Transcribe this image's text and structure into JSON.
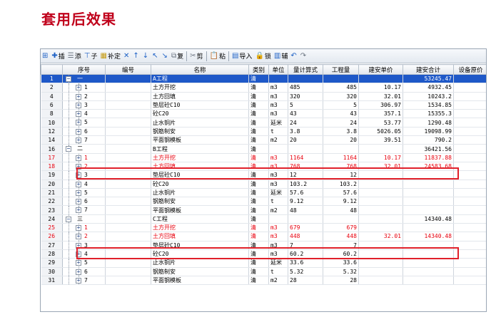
{
  "heading": "套用后效果",
  "toolbar": {
    "insert": "插",
    "add": "添",
    "child": "子",
    "supplement": "补定",
    "copy": "复",
    "cut": "剪",
    "paste": "粘",
    "import": "导入",
    "lock": "锁",
    "aux": "辅"
  },
  "columns": [
    "序号",
    "编号",
    "名称",
    "类别",
    "单位",
    "量计算式",
    "工程量",
    "建安单价",
    "建安合计",
    "设备原价"
  ],
  "rows": [
    {
      "row": "1",
      "seq": "一",
      "code": "",
      "name": "A工程",
      "type": "清",
      "unit": "",
      "formula": "",
      "qty": "",
      "price": "",
      "total": "53245.47",
      "level": 1,
      "state": "selected"
    },
    {
      "row": "2",
      "seq": "1",
      "code": "",
      "name": "土方开挖",
      "type": "清",
      "unit": "m3",
      "formula": "485",
      "qty": "485",
      "price": "10.17",
      "total": "4932.45",
      "level": 2,
      "state": ""
    },
    {
      "row": "4",
      "seq": "2",
      "code": "",
      "name": "土方回填",
      "type": "清",
      "unit": "m3",
      "formula": "320",
      "qty": "320",
      "price": "32.01",
      "total": "10243.2",
      "level": 2,
      "state": ""
    },
    {
      "row": "6",
      "seq": "3",
      "code": "",
      "name": "垫层砼C10",
      "type": "清",
      "unit": "m3",
      "formula": "5",
      "qty": "5",
      "price": "306.97",
      "total": "1534.85",
      "level": 2,
      "state": ""
    },
    {
      "row": "8",
      "seq": "4",
      "code": "",
      "name": "砼C20",
      "type": "清",
      "unit": "m3",
      "formula": "43",
      "qty": "43",
      "price": "357.1",
      "total": "15355.3",
      "level": 2,
      "state": ""
    },
    {
      "row": "10",
      "seq": "5",
      "code": "",
      "name": "止水铜片",
      "type": "清",
      "unit": "延米",
      "formula": "24",
      "qty": "24",
      "price": "53.77",
      "total": "1290.48",
      "level": 2,
      "state": ""
    },
    {
      "row": "12",
      "seq": "6",
      "code": "",
      "name": "钢筋制安",
      "type": "清",
      "unit": "t",
      "formula": "3.8",
      "qty": "3.8",
      "price": "5026.05",
      "total": "19098.99",
      "level": 2,
      "state": ""
    },
    {
      "row": "14",
      "seq": "7",
      "code": "",
      "name": "平面钢模板",
      "type": "清",
      "unit": "m2",
      "formula": "20",
      "qty": "20",
      "price": "39.51",
      "total": "790.2",
      "level": 2,
      "state": ""
    },
    {
      "row": "16",
      "seq": "二",
      "code": "",
      "name": "B工程",
      "type": "清",
      "unit": "",
      "formula": "",
      "qty": "",
      "price": "",
      "total": "36421.56",
      "level": 1,
      "state": ""
    },
    {
      "row": "17",
      "seq": "1",
      "code": "",
      "name": "土方开挖",
      "type": "清",
      "unit": "m3",
      "formula": "1164",
      "qty": "1164",
      "price": "10.17",
      "total": "11837.88",
      "level": 2,
      "state": "highlight"
    },
    {
      "row": "18",
      "seq": "2",
      "code": "",
      "name": "土方回填",
      "type": "清",
      "unit": "m3",
      "formula": "768",
      "qty": "768",
      "price": "32.01",
      "total": "24583.68",
      "level": 2,
      "state": "highlight"
    },
    {
      "row": "19",
      "seq": "3",
      "code": "",
      "name": "垫层砼C10",
      "type": "清",
      "unit": "m3",
      "formula": "12",
      "qty": "12",
      "price": "",
      "total": "",
      "level": 2,
      "state": ""
    },
    {
      "row": "20",
      "seq": "4",
      "code": "",
      "name": "砼C20",
      "type": "清",
      "unit": "m3",
      "formula": "103.2",
      "qty": "103.2",
      "price": "",
      "total": "",
      "level": 2,
      "state": ""
    },
    {
      "row": "21",
      "seq": "5",
      "code": "",
      "name": "止水铜片",
      "type": "清",
      "unit": "延米",
      "formula": "57.6",
      "qty": "57.6",
      "price": "",
      "total": "",
      "level": 2,
      "state": ""
    },
    {
      "row": "22",
      "seq": "6",
      "code": "",
      "name": "钢筋制安",
      "type": "清",
      "unit": "t",
      "formula": "9.12",
      "qty": "9.12",
      "price": "",
      "total": "",
      "level": 2,
      "state": ""
    },
    {
      "row": "23",
      "seq": "7",
      "code": "",
      "name": "平面钢模板",
      "type": "清",
      "unit": "m2",
      "formula": "48",
      "qty": "48",
      "price": "",
      "total": "",
      "level": 2,
      "state": ""
    },
    {
      "row": "24",
      "seq": "三",
      "code": "",
      "name": "C工程",
      "type": "清",
      "unit": "",
      "formula": "",
      "qty": "",
      "price": "",
      "total": "14340.48",
      "level": 1,
      "state": ""
    },
    {
      "row": "25",
      "seq": "1",
      "code": "",
      "name": "土方开挖",
      "type": "清",
      "unit": "m3",
      "formula": "679",
      "qty": "679",
      "price": "",
      "total": "",
      "level": 2,
      "state": "highlight"
    },
    {
      "row": "26",
      "seq": "2",
      "code": "",
      "name": "土方回填",
      "type": "清",
      "unit": "m3",
      "formula": "448",
      "qty": "448",
      "price": "32.01",
      "total": "14340.48",
      "level": 2,
      "state": "highlight"
    },
    {
      "row": "27",
      "seq": "3",
      "code": "",
      "name": "垫层砼C10",
      "type": "清",
      "unit": "m3",
      "formula": "7",
      "qty": "7",
      "price": "",
      "total": "",
      "level": 2,
      "state": ""
    },
    {
      "row": "28",
      "seq": "4",
      "code": "",
      "name": "砼C20",
      "type": "清",
      "unit": "m3",
      "formula": "60.2",
      "qty": "60.2",
      "price": "",
      "total": "",
      "level": 2,
      "state": ""
    },
    {
      "row": "29",
      "seq": "5",
      "code": "",
      "name": "止水铜片",
      "type": "清",
      "unit": "延米",
      "formula": "33.6",
      "qty": "33.6",
      "price": "",
      "total": "",
      "level": 2,
      "state": ""
    },
    {
      "row": "30",
      "seq": "6",
      "code": "",
      "name": "钢筋制安",
      "type": "清",
      "unit": "t",
      "formula": "5.32",
      "qty": "5.32",
      "price": "",
      "total": "",
      "level": 2,
      "state": ""
    },
    {
      "row": "31",
      "seq": "7",
      "code": "",
      "name": "平面钢模板",
      "type": "清",
      "unit": "m2",
      "formula": "28",
      "qty": "28",
      "price": "",
      "total": "",
      "level": 2,
      "state": ""
    }
  ],
  "colors": {
    "heading": "#c0001b",
    "selected_row": "#1e58c8",
    "highlight_text": "#e8000d",
    "callout_box": "#e0202a"
  }
}
